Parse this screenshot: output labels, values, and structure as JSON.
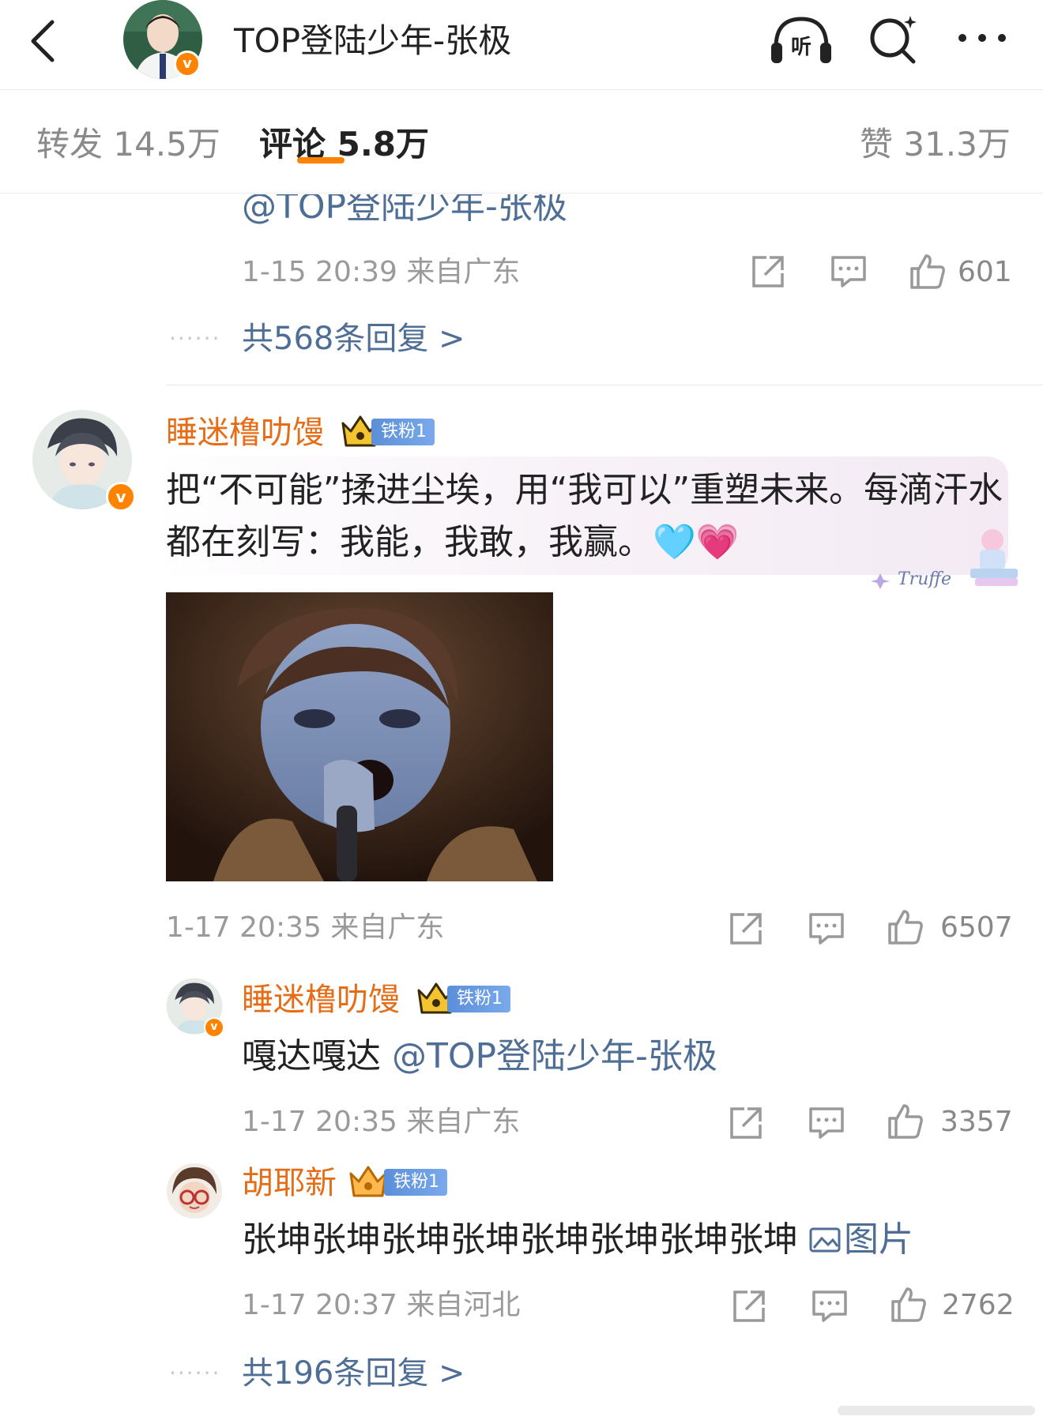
{
  "header": {
    "title": "TOP登陆少年-张极",
    "listen_label": "听",
    "verify_mark": "v"
  },
  "tabs": {
    "reposts": "转发 14.5万",
    "comments": "评论 5.8万",
    "likes": "赞 31.3万"
  },
  "top_comment": {
    "mention": "@TOP登陆少年-张极",
    "meta": "1-15 20:39  来自广东",
    "likes": "601",
    "replies_label": "共568条回复 >",
    "dots": "······"
  },
  "main_comment": {
    "username": "睡迷橹叻馒",
    "fan_badge": "铁粉1",
    "text": "把“不可能”揉进尘埃，用“我可以”重塑未来。每滴汗水都在刻写：我能，我敢，我赢。",
    "emojis": "🩵💗",
    "signature": "Truffe",
    "meta": "1-17 20:35  来自广东",
    "likes": "6507",
    "verify_mark": "v"
  },
  "reply_1": {
    "username": "睡迷橹叻馒",
    "fan_badge": "铁粉1",
    "text": "嘎达嘎达 ",
    "mention": "@TOP登陆少年-张极",
    "meta": "1-17 20:35  来自广东",
    "likes": "3357",
    "verify_mark": "v"
  },
  "reply_2": {
    "username": "胡耶新",
    "fan_badge": "铁粉1",
    "text": "张坤张坤张坤张坤张坤张坤张坤张坤 ",
    "image_link": "图片",
    "meta": "1-17 20:37  来自河北",
    "likes": "2762"
  },
  "bottom_replies": {
    "label": "共196条回复 >",
    "dots": "······"
  },
  "colors": {
    "accent": "#ff8200",
    "username": "#e66d17",
    "link": "#4f6e95",
    "meta": "#9a9a9a"
  }
}
